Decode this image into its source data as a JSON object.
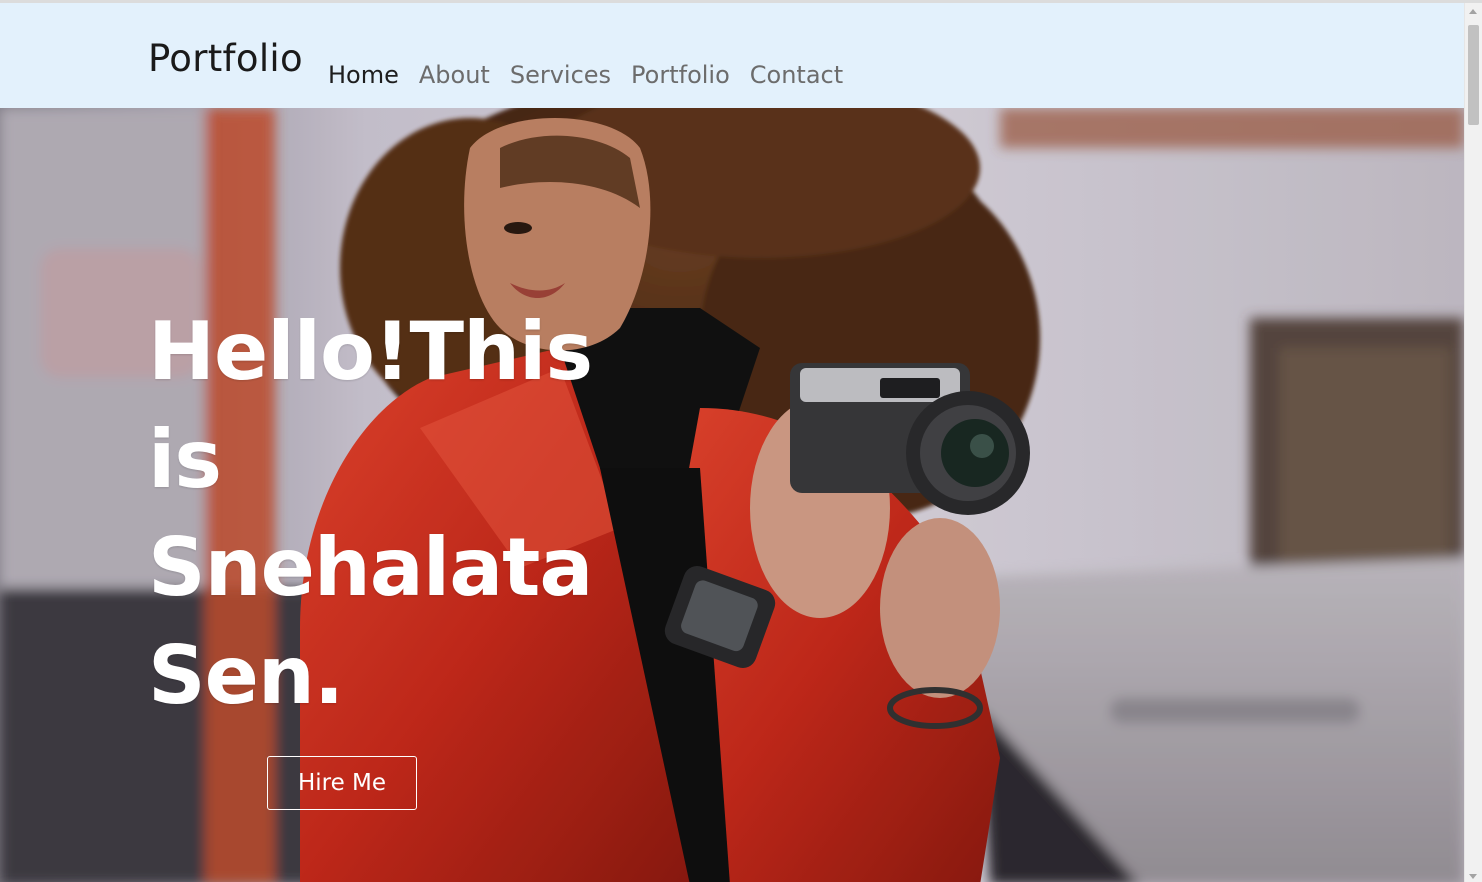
{
  "navbar": {
    "brand": "Portfolio",
    "items": [
      {
        "label": "Home",
        "active": true
      },
      {
        "label": "About",
        "active": false
      },
      {
        "label": "Services",
        "active": false
      },
      {
        "label": "Portfolio",
        "active": false
      },
      {
        "label": "Contact",
        "active": false
      }
    ]
  },
  "hero": {
    "title_lines": [
      "Hello!This",
      "is",
      "Snehalata",
      "Sen."
    ],
    "button_label": "Hire Me",
    "image_subject": "woman-with-camera-photo"
  },
  "colors": {
    "navbar_bg": "#e3f1fc",
    "active_link": "#1e1e1e",
    "inactive_link": "#6c6c6c",
    "hero_text": "#ffffff",
    "jacket_red": "#d2301f"
  }
}
